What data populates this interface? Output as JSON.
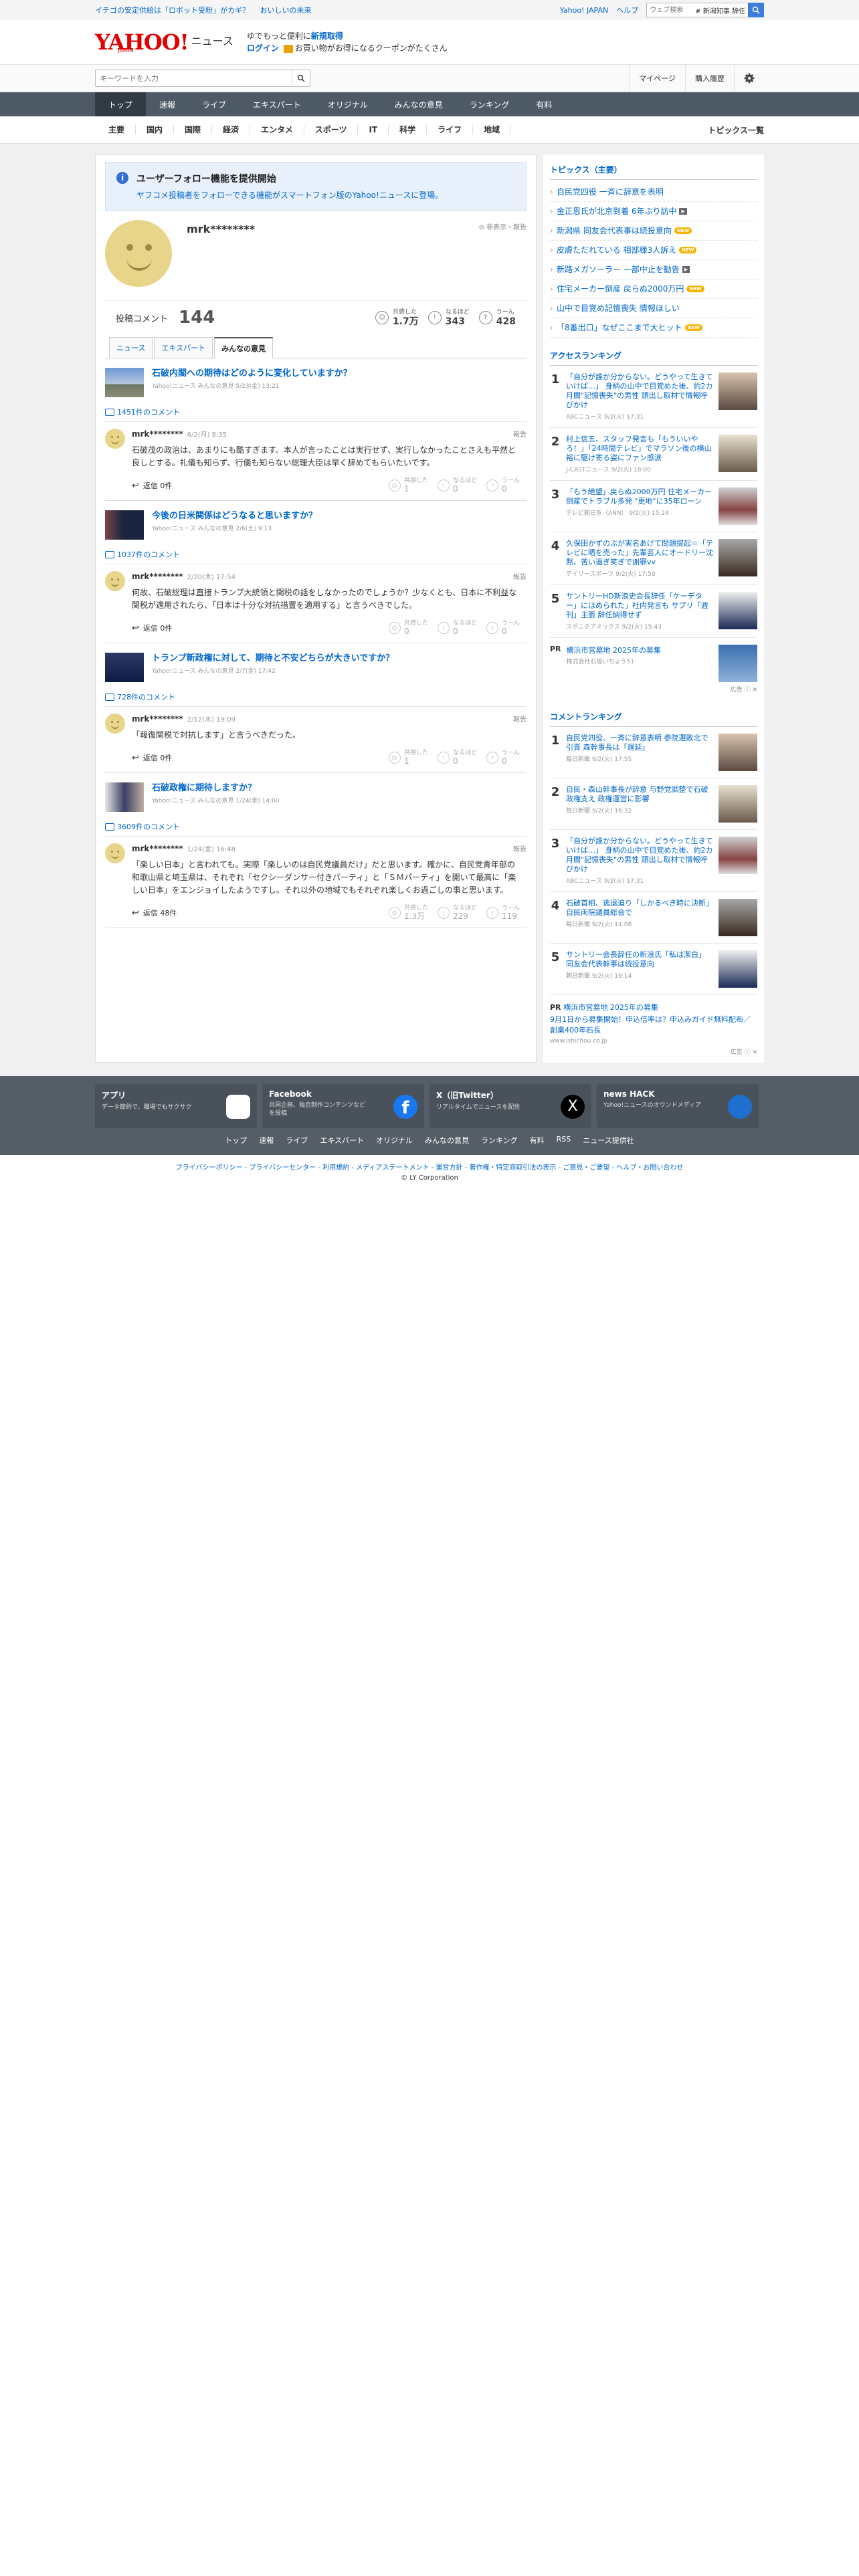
{
  "topbar": {
    "promo1": "イチゴの安定供給は「ロボット受粉」がカギ？",
    "promo2": "おいしいの未来",
    "yahoo_japan": "Yahoo! JAPAN",
    "help": "ヘルプ",
    "web_search_placeholder": "ウェブ検索",
    "web_search_tag": "# 新潟知事 辞任"
  },
  "brand": {
    "logo": "YAHOO!",
    "logo_sub": "JAPAN",
    "news": "ニュース",
    "tagline1": "ゆでもっと便利に",
    "tagline1_bold": "新規取得",
    "login": "ログイン",
    "tagline2": "お買い物がお得になるクーポンがたくさん"
  },
  "search": {
    "placeholder": "キーワードを入力",
    "mypage": "マイページ",
    "history": "購入履歴"
  },
  "nav": {
    "tabs": [
      "トップ",
      "速報",
      "ライブ",
      "エキスパート",
      "オリジナル",
      "みんなの意見",
      "ランキング",
      "有料"
    ],
    "categories": [
      "主要",
      "国内",
      "国際",
      "経済",
      "エンタメ",
      "スポーツ",
      "IT",
      "科学",
      "ライフ",
      "地域"
    ],
    "topics_all": "トピックス一覧"
  },
  "notice": {
    "title": "ユーザーフォロー機能を提供開始",
    "desc": "ヤフコメ投稿者をフォローできる機能がスマートフォン版のYahoo!ニュースに登場。"
  },
  "profile": {
    "name": "mrk********",
    "report": "非表示・報告",
    "posts_label": "投稿コメント",
    "posts_count": "144",
    "reactions": [
      {
        "label": "共感した",
        "value": "1.7万"
      },
      {
        "label": "なるほど",
        "value": "343"
      },
      {
        "label": "うーん",
        "value": "428"
      }
    ]
  },
  "tabs": [
    "ニュース",
    "エキスパート",
    "みんなの意見"
  ],
  "items": [
    {
      "title": "石破内閣への期待はどのように変化していますか？",
      "meta": "Yahoo!ニュース みんなの意見 5/23(金) 13:21",
      "count": "1451件のコメント",
      "user": "mrk********",
      "date": "6/2(月) 8:35",
      "report": "報告",
      "text": "石破茂の政治は、あまりにも酷すぎます。本人が言ったことは実行せず、実行しなかったことさえも平然と良しとする。礼儀も知らず、行儀も知らない総理大臣は早く辞めてもらいたいです。",
      "reply": "返信 0件",
      "r": [
        "1",
        "0",
        "0"
      ]
    },
    {
      "title": "今後の日米関係はどうなると思いますか？",
      "meta": "Yahoo!ニュース みんなの意見 2/6(土) 9:13",
      "count": "1037件のコメント",
      "user": "mrk********",
      "date": "2/20(木) 17:54",
      "report": "報告",
      "text": "何故、石破総理は直接トランプ大統領と関税の話をしなかったのでしょうか？少なくとも、日本に不利益な関税が適用されたら、「日本は十分な対抗措置を適用する」と言うべきでした。",
      "reply": "返信 0件",
      "r": [
        "0",
        "0",
        "0"
      ]
    },
    {
      "title": "トランプ新政権に対して、期待と不安どちらが大きいですか？",
      "meta": "Yahoo!ニュース みんなの意見 2/7(金) 17:42",
      "count": "728件のコメント",
      "user": "mrk********",
      "date": "2/12(水) 19:09",
      "report": "報告",
      "text": "「報復関税で対抗します」と言うべきだった。",
      "reply": "返信 0件",
      "r": [
        "1",
        "0",
        "0"
      ]
    },
    {
      "title": "石破政権に期待しますか？",
      "meta": "Yahoo!ニュース みんなの意見 1/24(金) 14:00",
      "count": "3609件のコメント",
      "user": "mrk********",
      "date": "1/24(金) 16:48",
      "report": "報告",
      "text": "「楽しい日本」と言われても。実際「楽しいのは自民党議員だけ」だと思います。確かに、自民党青年部の和歌山県と埼玉県は、それぞれ「セクシーダンサー付きパーティ」と「ＳＭパーティ」を開いて最高に「楽しい日本」をエンジョイしたようですし。それ以外の地域でもそれぞれ楽しくお過ごしの事と思います。",
      "reply": "返信 48件",
      "r": [
        "1.3万",
        "229",
        "119"
      ]
    }
  ],
  "reaction_labels": [
    "共感した",
    "なるほど",
    "うーん"
  ],
  "sidebar": {
    "topics_title": "トピックス（主要）",
    "topics": [
      {
        "text": "自民党四役 一斉に辞意を表明",
        "badge": ""
      },
      {
        "text": "金正恩氏が北京到着 6年ぶり訪中",
        "badge": "cam"
      },
      {
        "text": "新潟県 同友会代表事は続投意向",
        "badge": "new"
      },
      {
        "text": "皮膚ただれている 相部様3人訴え",
        "badge": "new"
      },
      {
        "text": "新路メガソーラー 一部中止を勧告",
        "badge": "cam"
      },
      {
        "text": "住宅メーカー倒産 戻らぬ2000万円",
        "badge": "new"
      },
      {
        "text": "山中で目覚め記憶喪失 情報ほしい",
        "badge": ""
      },
      {
        "text": "「8番出口」なぜここまで大ヒット",
        "badge": "new"
      }
    ],
    "access_title": "アクセスランキング",
    "access": [
      {
        "n": "1",
        "t": "「自分が誰か分からない。どうやって生きていけば…」 身柄の山中で目覚めた後、約2カ月間\"記憶喪失\"の男性 頭出し取材で情報呼びかけ",
        "m": "ABCニュース 9/2(火) 17:31"
      },
      {
        "n": "2",
        "t": "村上信五、スタッフ発言も「もういいやろ！」「24時間テレビ」でマラソン後の横山裕に駆け寄る姿にファン感涙",
        "m": "J-CASTニュース 9/2(火) 18:00"
      },
      {
        "n": "3",
        "t": "「もう絶望」戻らぬ2000万円 住宅メーカー倒産でトラブル多発 \"更地\"に35年ローン",
        "m": "テレビ朝日系（ANN） 9/2(火) 15:24"
      },
      {
        "n": "4",
        "t": "久保田かずのぶが実名あげて問題提起＝「テレビに晒を売った」先輩芸人にオードリー沈黙、苦い過ぎ笑ぎで謝罪vv",
        "m": "デイリースポーツ 9/2(火) 17:59"
      },
      {
        "n": "5",
        "t": "サントリーHD新浪史会長辞任「ケーデター」にはめられた」社内発言も サプリ「週刊」主張 辞任納得せず",
        "m": "スポニチアネックス 9/2(火) 15:43"
      }
    ],
    "pr1": {
      "label": "PR",
      "title": "横浜市営墓地 2025年の募集",
      "meta": "株式会社石坂いちょう51"
    },
    "ad": "広告",
    "comment_title": "コメントランキング",
    "comments": [
      {
        "n": "1",
        "t": "自民党四役、一斉に辞意表明 参院選敗北で引責 森幹事長は「遅延」",
        "m": "毎日新聞 9/2(火) 17:55"
      },
      {
        "n": "2",
        "t": "自民・森山幹事長が辞意 与野党調整で石破政権支え 政権運営に影響",
        "m": "毎日新聞 9/2(火) 16:32"
      },
      {
        "n": "3",
        "t": "「自分が誰か分からない。どうやって生きていけば…」 身柄の山中で目覚めた後、約2カ月間\"記憶喪失\"の男性 頭出し取材で情報呼びかけ",
        "m": "ABCニュース 9/2(火) 17:31"
      },
      {
        "n": "4",
        "t": "石破首相、逃退迫り「しかるべき時に決断」 自民両院議員総会で",
        "m": "毎日新聞 9/2(火) 14:08"
      },
      {
        "n": "5",
        "t": "サントリー会長辞任の新浪氏「私は潔白」 同友会代表幹事は続投意向",
        "m": "朝日新聞 9/2(火) 19:14"
      }
    ],
    "pr2": {
      "label": "PR",
      "title": "横浜市営墓地 2025年の募集",
      "desc": "9月1日から募集開始！申込倍率は？申込みガイド無料配布／創業400年石長",
      "url": "www.ishichou.co.jp"
    }
  },
  "footer": {
    "cards": [
      {
        "h": "アプリ",
        "s": "データ節約で、職場でもサクサク"
      },
      {
        "h": "Facebook",
        "s": "共同企画、独自制作コンテンツなどを投稿"
      },
      {
        "h": "X（旧Twitter）",
        "s": "リアルタイムでニュースを配信"
      },
      {
        "h": "news HACK",
        "s": "Yahoo!ニュースのオウンドメディア"
      }
    ],
    "links": [
      "トップ",
      "速報",
      "ライブ",
      "エキスパート",
      "オリジナル",
      "みんなの意見",
      "ランキング",
      "有料",
      "RSS",
      "ニュース提供社"
    ],
    "legal": "プライバシーポリシー - プライバシーセンター - 利用規約 - メディアステートメント - 運営方針 - 著作権・特定商取引法の表示 - ご意見・ご要望 - ヘルプ・お問い合わせ",
    "copyright": "© LY Corporation"
  },
  "colors": {
    "accent": "#0066cc",
    "nav": "#4d5a66",
    "brand_red": "#e00000"
  }
}
